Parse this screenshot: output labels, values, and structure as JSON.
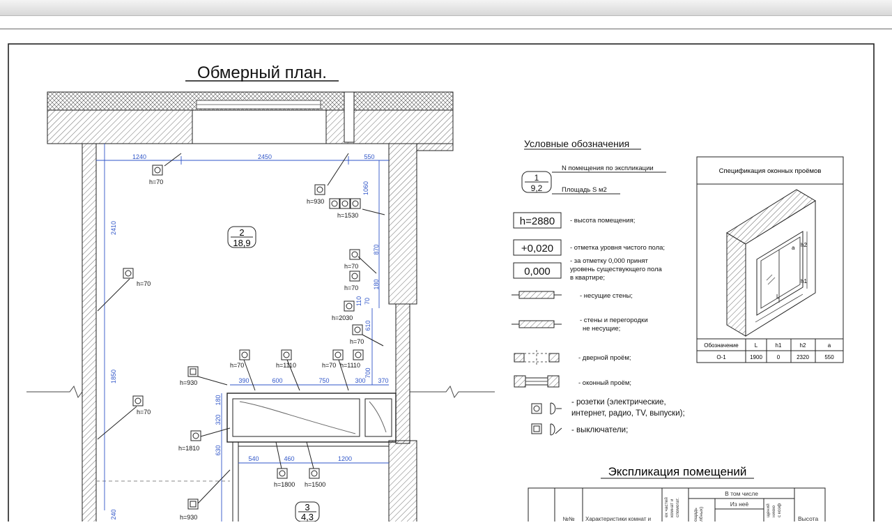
{
  "plan": {
    "title": "Обмерный план.",
    "dims": {
      "d1240": "1240",
      "d2450": "2450",
      "d550": "550",
      "d1060": "1060",
      "d2410": "2410",
      "d870": "870",
      "d180": "180",
      "d110": "110",
      "d70": "70",
      "d610": "610",
      "d700": "700",
      "d1850": "1850",
      "d390": "390",
      "d600": "600",
      "d750": "750",
      "d300": "300",
      "d370": "370",
      "d320": "320",
      "d630": "630",
      "d540": "540",
      "d460": "460",
      "d1200": "1200",
      "d240": "240"
    },
    "heights": {
      "h70a": "h=70",
      "h930a": "h=930",
      "h1530": "h=1530",
      "h70b": "h=70",
      "h70c": "h=70",
      "h70d": "h=70",
      "h2030": "h=2030",
      "h70e": "h=70",
      "h70f": "h=70",
      "h1110a": "h=1110",
      "h70g": "h=70",
      "h1110b": "h=1110",
      "h930b": "h=930",
      "h70h": "h=70",
      "h1810": "h=1810",
      "h1800": "h=1800",
      "h1500": "h=1500",
      "h930c": "h=930"
    },
    "rooms": [
      {
        "num": "2",
        "area": "18,9"
      },
      {
        "num": "3",
        "area": "4,3"
      }
    ]
  },
  "legend": {
    "title": "Условные обозначения",
    "room_num_label": "N помещения по экспликации",
    "area_label": "Площадь S м2",
    "sample_num": "1",
    "sample_area": "9,2",
    "height_box": "h=2880",
    "height_desc": "- высота помещения;",
    "level_box": "+0,020",
    "level_desc": "- отметка уровня чистого пола;",
    "zero_box": "0,000",
    "zero_desc_1": "- за отметку 0,000 принят",
    "zero_desc_2": "уровень существующего пола",
    "zero_desc_3": "в квартире;",
    "bearing": "- несущие стены;",
    "nonbearing_1": "- стены и перегородки",
    "nonbearing_2": "не несущие;",
    "door": "- дверной проём;",
    "window": "- оконный проём;",
    "sockets_1": "- розетки (электрические,",
    "sockets_2": "интернет, радио, TV, выпуски);",
    "switches": "- выключатели;"
  },
  "window_spec": {
    "title": "Спецификация оконных проёмов",
    "labels": {
      "a": "a",
      "h2": "h2",
      "h1": "h1",
      "L": "L"
    },
    "headers": [
      "Обозначение",
      "L",
      "h1",
      "h2",
      "a"
    ],
    "rows": [
      [
        "О-1",
        "1900",
        "0",
        "2320",
        "550"
      ]
    ]
  },
  "explication": {
    "title": "Экспликация помещений",
    "hdr_incl": "В том числе",
    "hdr_of_which": "Из неё",
    "hdr_num": "№№",
    "hdr_char": "Характеристики комнат и",
    "hdr_height": "Высота",
    "hdr_v1": "ех частей",
    "hdr_v2": "комнат и",
    "hdr_v3": "спомогат.",
    "hdr_v4": "ощадь",
    "hdr_v5": "лбных)",
    "hdr_v6": "щений",
    "hdr_v7": "ниюю",
    "hdr_v8": "с коэф"
  }
}
